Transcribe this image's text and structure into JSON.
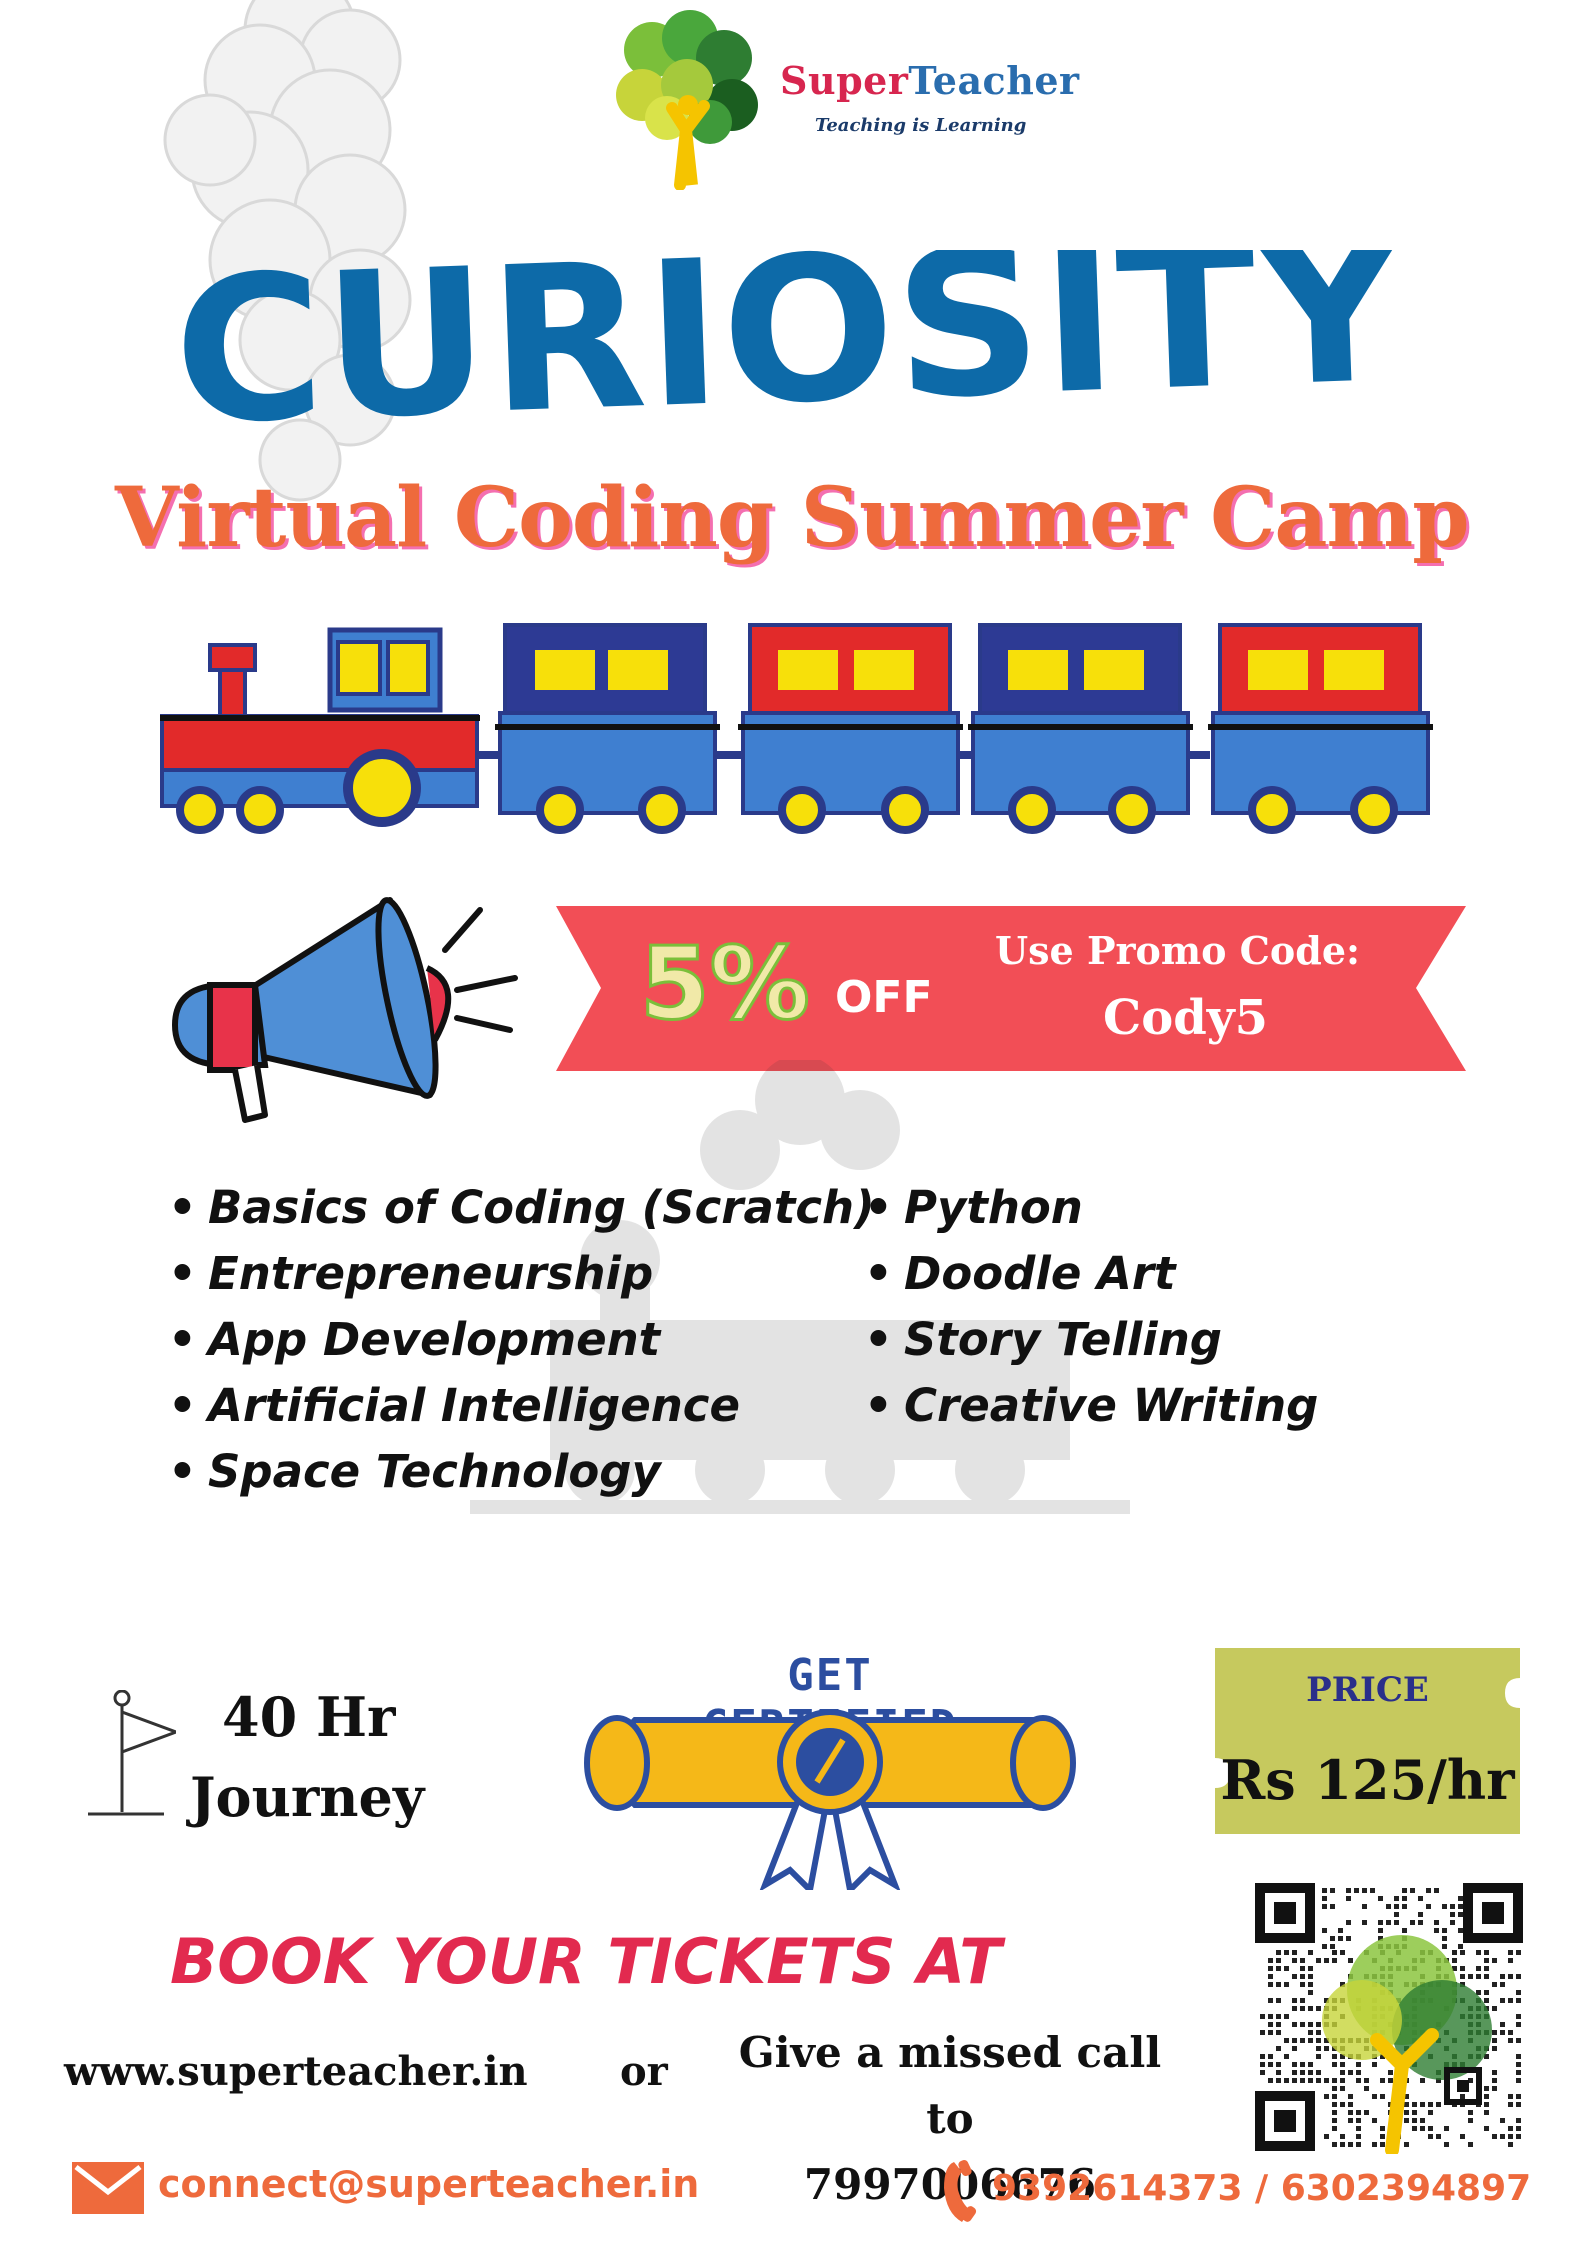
{
  "brand": {
    "name_part1": "Super",
    "name_part2": "Teacher",
    "tagline": "Teaching is Learning"
  },
  "title": "CURIOSITY",
  "subtitle": "Virtual Coding Summer Camp",
  "promo": {
    "percent": "5%",
    "off_label": "OFF",
    "use_label": "Use Promo Code:",
    "code": "Cody5"
  },
  "topics_left": [
    "Basics of Coding (Scratch)",
    "Entrepreneurship",
    "App Development",
    "Artificial Intelligence",
    "Space Technology"
  ],
  "topics_right": [
    "Python",
    "Doodle Art",
    "Story Telling",
    "Creative Writing"
  ],
  "journey": {
    "hours": "40 Hr",
    "word": "Journey"
  },
  "certified": "GET CERTIFIED",
  "price": {
    "label": "PRICE",
    "value": "Rs 125/hr"
  },
  "booking": {
    "heading": "BOOK YOUR TICKETS AT",
    "website": "www.superteacher.in",
    "or": "or",
    "missed_call_line": "Give a missed call to",
    "missed_call_number": "7997006676"
  },
  "contact": {
    "email": "connect@superteacher.in",
    "phones": "9392614373 / 6302394897"
  },
  "colors": {
    "title_blue": "#0d6aa8",
    "accent_orange": "#ee6a3c",
    "ribbon_red": "#f24e56",
    "book_red": "#e22a4f",
    "ticket_olive": "#c6c95e"
  },
  "icons": [
    "logo-tree-icon",
    "train-icon",
    "megaphone-icon",
    "flag-icon",
    "certificate-scroll-icon",
    "ticket-icon",
    "qr-code",
    "mail-icon",
    "phone-icon"
  ]
}
